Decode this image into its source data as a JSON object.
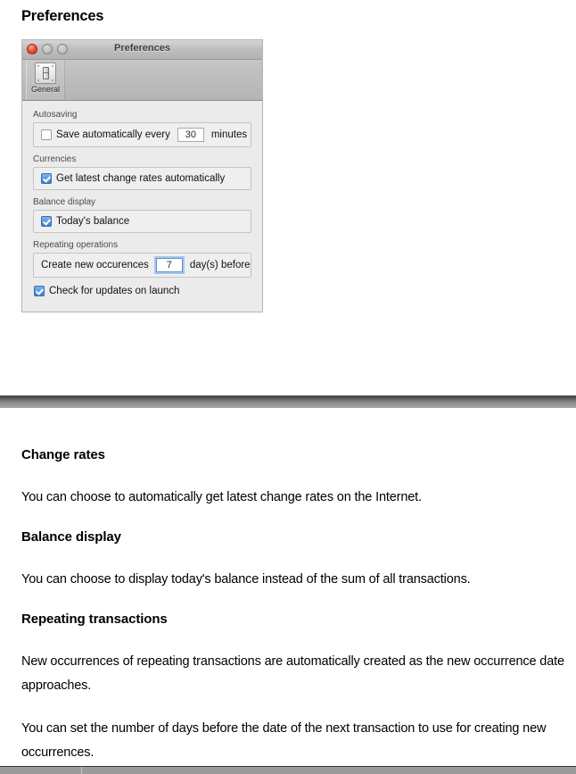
{
  "doc_top": {
    "title": "Preferences"
  },
  "prefs_window": {
    "titlebar": {
      "title": "Preferences",
      "close_tooltip": "Close",
      "minimize_tooltip": "Minimize",
      "zoom_tooltip": "Zoom"
    },
    "toolbar": {
      "items": [
        {
          "label": "General",
          "icon": "switch-plate-icon",
          "selected": true
        }
      ]
    },
    "groups": [
      {
        "label": "Autosaving",
        "checkbox": {
          "label": "Save automatically every",
          "checked": false
        },
        "field": {
          "value": "30",
          "focused": false
        },
        "suffix": "minutes"
      },
      {
        "label": "Currencies",
        "checkbox": {
          "label": "Get latest change rates automatically",
          "checked": true
        }
      },
      {
        "label": "Balance display",
        "checkbox": {
          "label": "Today's balance",
          "checked": true
        }
      },
      {
        "label": "Repeating operations",
        "prefix": "Create new occurences",
        "field": {
          "value": "7",
          "focused": true
        },
        "suffix": "day(s) before"
      }
    ],
    "footer_checkbox": {
      "label": "Check for updates on launch",
      "checked": true
    }
  },
  "doc_bottom": {
    "sections": [
      {
        "heading": "Change rates",
        "paragraphs": [
          "You can choose to automatically get latest change rates on the Internet."
        ]
      },
      {
        "heading": "Balance display",
        "paragraphs": [
          "You can choose to display today's balance instead of the sum of all transactions."
        ]
      },
      {
        "heading": "Repeating transactions",
        "paragraphs": [
          "New occurrences of repeating transactions are automatically created as the new occurrence date approaches.",
          "You can set the number of days before the date of the next transaction to use for creating new occurrences."
        ]
      }
    ]
  },
  "colors": {
    "accent_checkbox": "#3d7fd6",
    "focus_ring": "#5a93d6",
    "window_chrome": "#bdbdbd",
    "window_body": "#ebebeb",
    "separator_dark": "#3f3f3f",
    "separator_light": "#a8a8a8"
  }
}
